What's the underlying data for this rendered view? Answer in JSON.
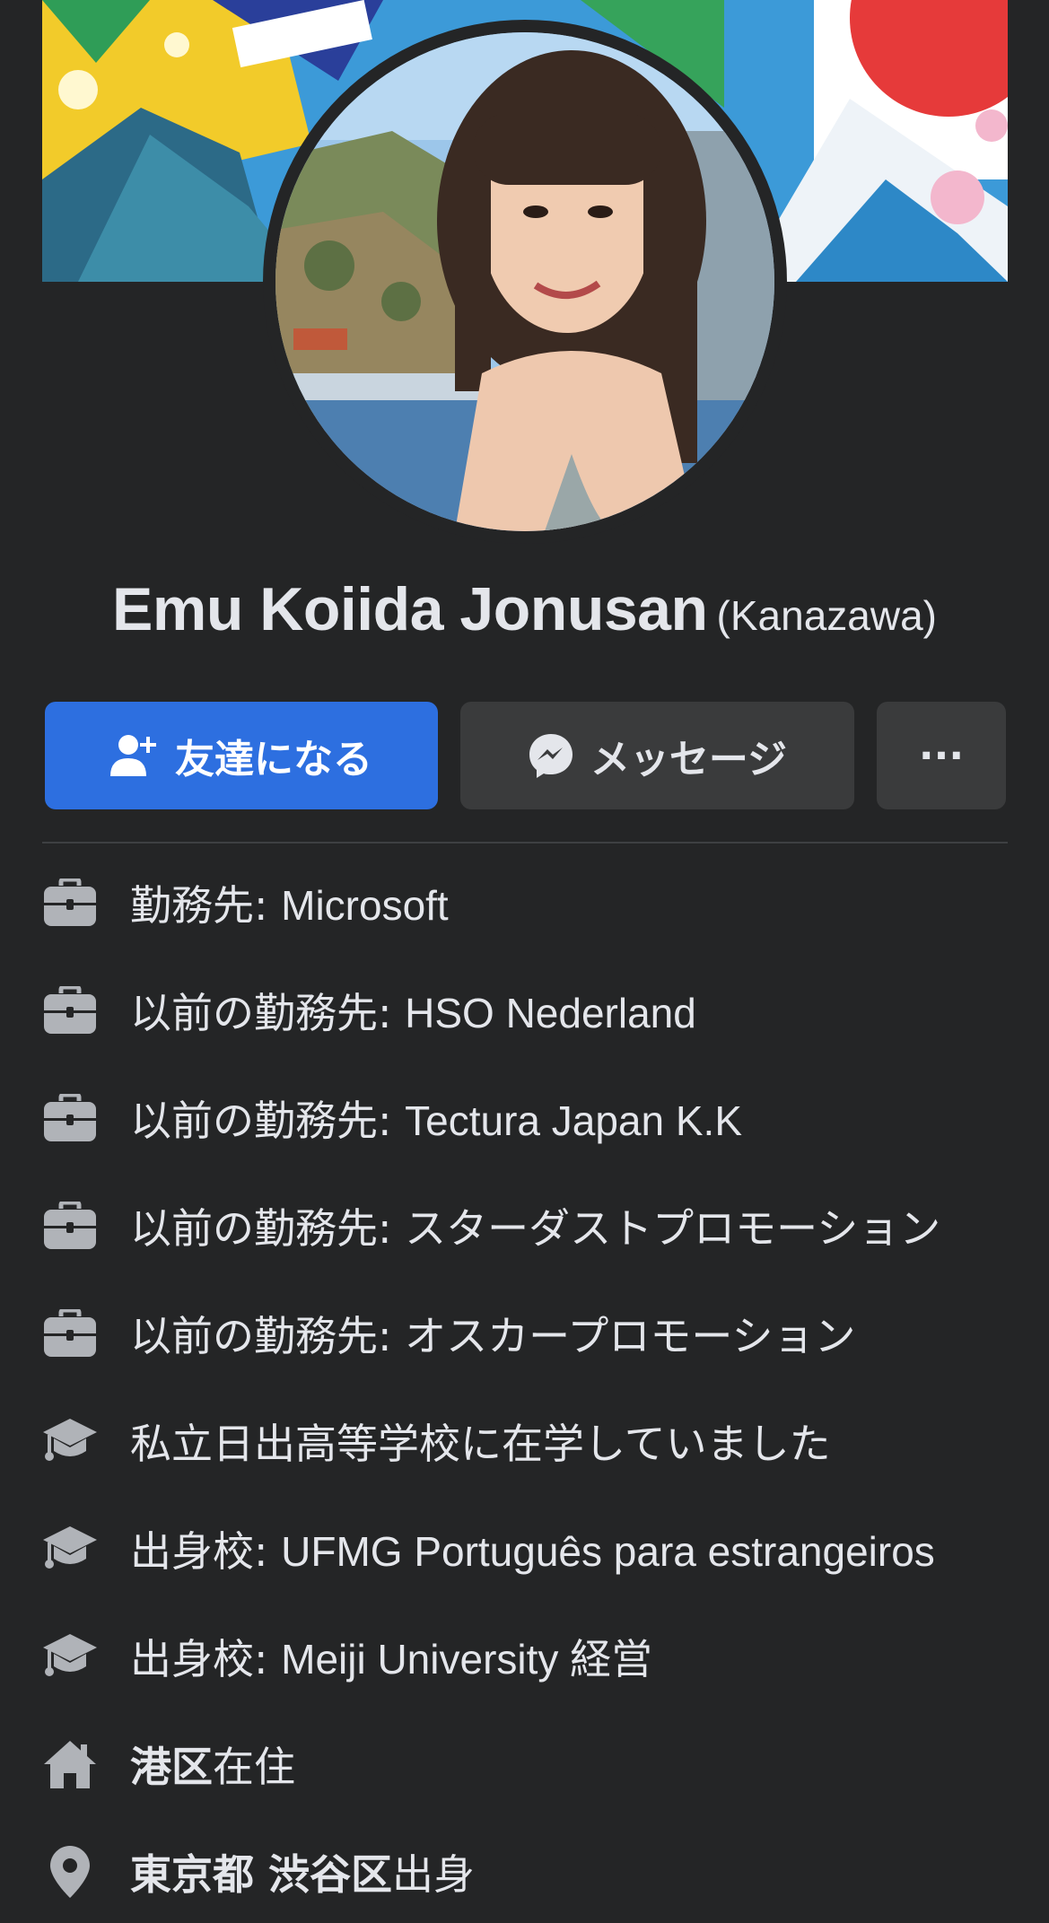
{
  "profile": {
    "name": "Emu Koiida Jonusan",
    "alternate_name": "(Kanazawa)"
  },
  "actions": {
    "add_friend_label": "友達になる",
    "message_label": "メッセージ",
    "more_label": "···"
  },
  "intro": [
    {
      "icon": "briefcase-icon",
      "prefix": "勤務先: ",
      "value": "Microsoft"
    },
    {
      "icon": "briefcase-icon",
      "prefix": "以前の勤務先: ",
      "value": "HSO Nederland"
    },
    {
      "icon": "briefcase-icon",
      "prefix": "以前の勤務先: ",
      "value": "Tectura Japan K.K"
    },
    {
      "icon": "briefcase-icon",
      "prefix": "以前の勤務先: ",
      "value": "スターダストプロモーション"
    },
    {
      "icon": "briefcase-icon",
      "prefix": "以前の勤務先: ",
      "value": "オスカープロモーション"
    },
    {
      "icon": "graduation-cap-icon",
      "prefix": "",
      "value": "私立日出高等学校に在学していました"
    },
    {
      "icon": "graduation-cap-icon",
      "prefix": "出身校: ",
      "value": "UFMG Português para estrangeiros"
    },
    {
      "icon": "graduation-cap-icon",
      "prefix": "出身校: ",
      "value": "Meiji University 経営"
    },
    {
      "icon": "home-icon",
      "bold": "港区",
      "suffix": "在住"
    },
    {
      "icon": "location-pin-icon",
      "bold": "東京都 渋谷区",
      "suffix": "出身"
    }
  ],
  "colors": {
    "background": "#242526",
    "primary_button": "#2d6fe0",
    "secondary_button": "#3a3b3c",
    "text": "#e4e6eb",
    "icon": "#b0b3b8"
  }
}
